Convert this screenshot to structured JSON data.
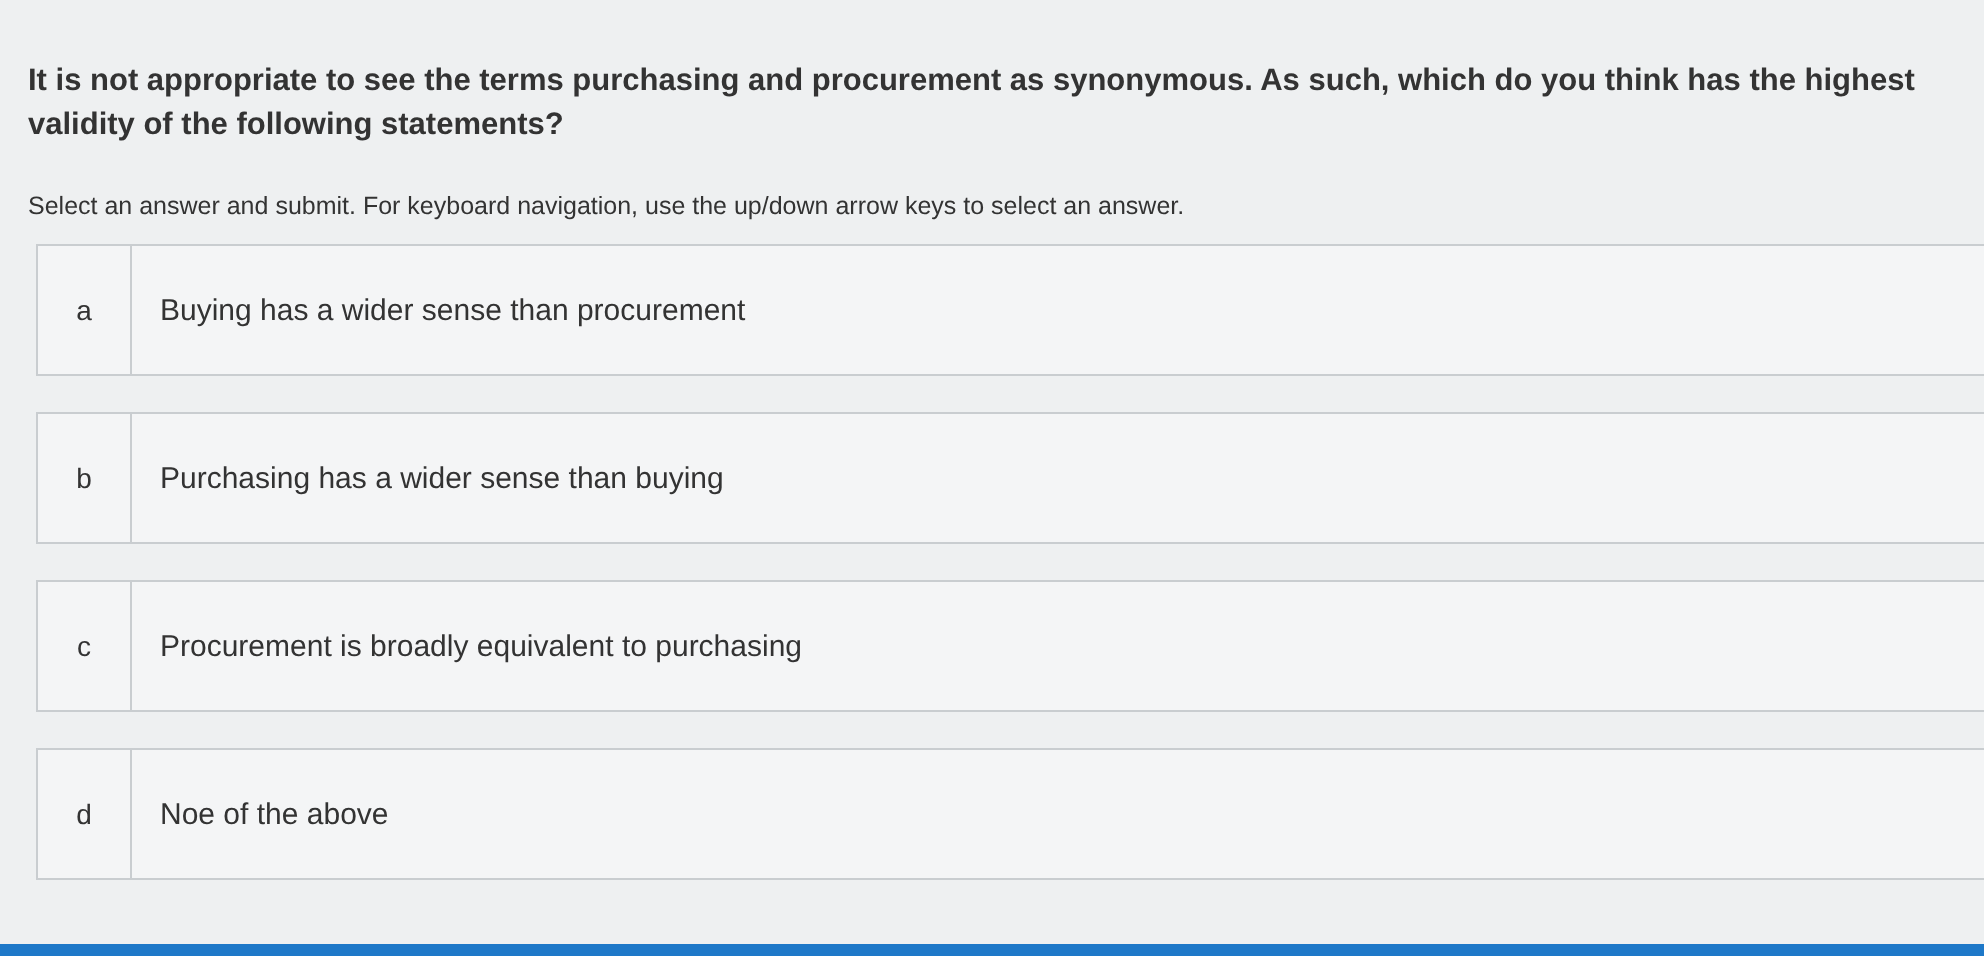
{
  "question": "It is not appropriate to see the terms purchasing and procurement as synonymous. As such, which do you think has the highest validity of the following statements?",
  "instructions": "Select an answer and submit. For keyboard navigation, use the up/down arrow keys to select an answer.",
  "options": [
    {
      "letter": "a",
      "text": "Buying has a wider sense than procurement",
      "selected": false
    },
    {
      "letter": "b",
      "text": "Purchasing has a wider sense than buying",
      "selected": false
    },
    {
      "letter": "c",
      "text": "Procurement is broadly equivalent to purchasing",
      "selected": false
    },
    {
      "letter": "d",
      "text": "Noe of the above",
      "selected": false
    }
  ]
}
